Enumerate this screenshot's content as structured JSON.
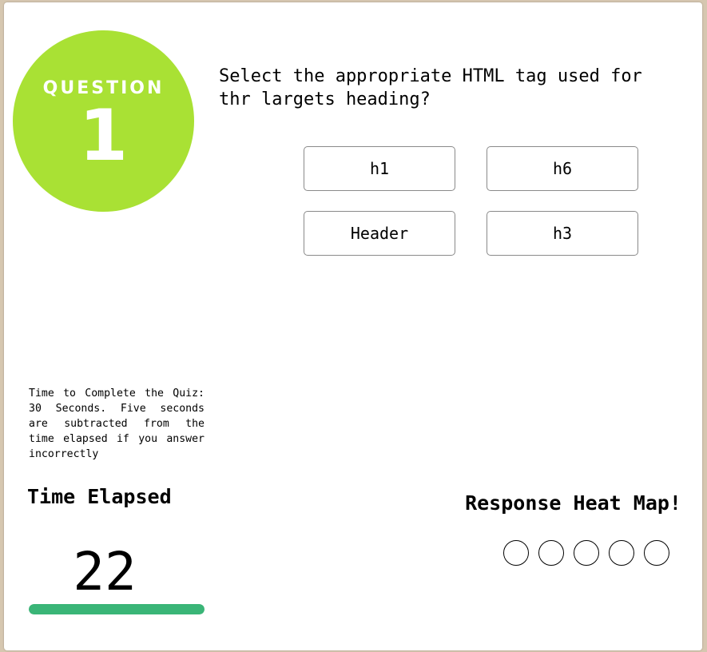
{
  "badge": {
    "label": "QUESTION",
    "number": "1",
    "color": "#a9e134"
  },
  "question": {
    "text": "Select the appropriate HTML tag used for thr largets heading?"
  },
  "answers": [
    {
      "label": "h1"
    },
    {
      "label": "h6"
    },
    {
      "label": "Header"
    },
    {
      "label": "h3"
    }
  ],
  "info": {
    "text": "Time to Complete the Quiz: 30 Seconds. Five seconds are subtracted from the time elapsed if you answer incorrectly"
  },
  "timer": {
    "title": "Time Elapsed",
    "value": "22",
    "progress_fraction": 1.0,
    "bar_color": "#3ab577"
  },
  "heatmap": {
    "title": "Response Heat Map!",
    "dots": [
      {
        "state": "empty"
      },
      {
        "state": "empty"
      },
      {
        "state": "empty"
      },
      {
        "state": "empty"
      },
      {
        "state": "empty"
      }
    ]
  }
}
